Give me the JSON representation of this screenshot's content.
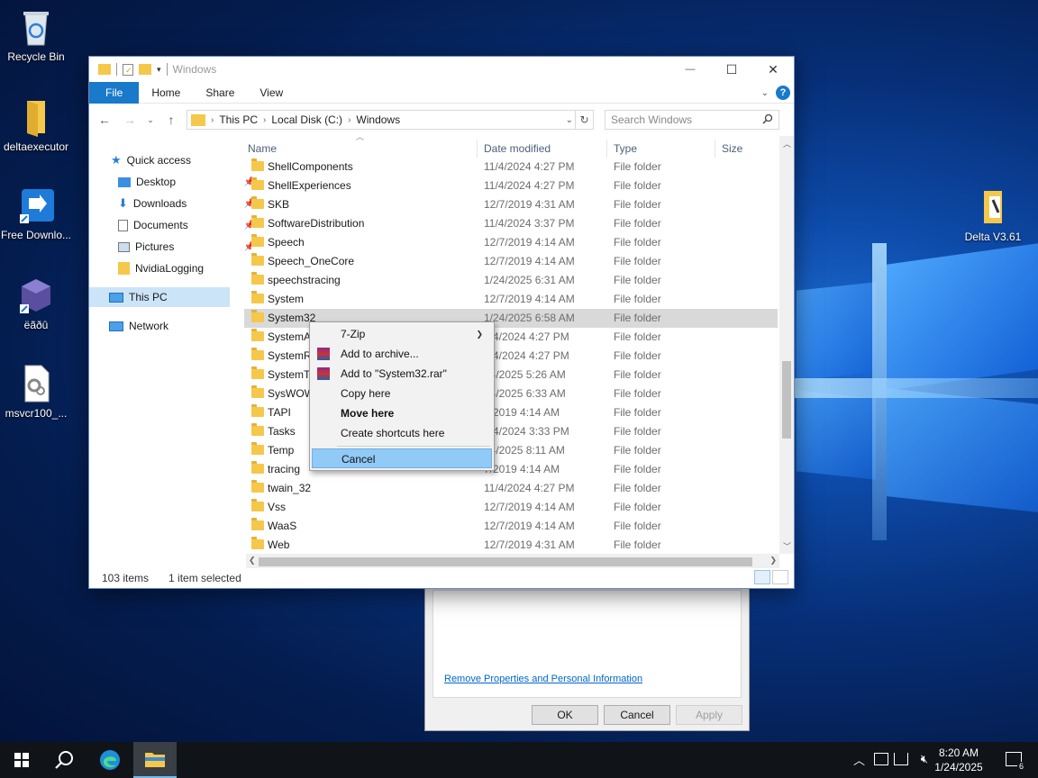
{
  "desktop": {
    "icons": [
      {
        "label": "Recycle Bin"
      },
      {
        "label": "deltaexecutor"
      },
      {
        "label": "Free Downlo..."
      },
      {
        "label": "ëãðû"
      },
      {
        "label": "msvcr100_..."
      },
      {
        "label": "Delta V3.61"
      }
    ]
  },
  "window": {
    "title": "Windows",
    "controls": {
      "minimize": "—",
      "maximize": "☐",
      "close": "✕"
    },
    "ribbon_tabs": [
      "File",
      "Home",
      "Share",
      "View"
    ],
    "address": {
      "crumbs": [
        "This PC",
        "Local Disk (C:)",
        "Windows"
      ]
    },
    "search": {
      "placeholder": "Search Windows"
    },
    "nav": [
      {
        "label": "Quick access"
      },
      {
        "label": "Desktop"
      },
      {
        "label": "Downloads"
      },
      {
        "label": "Documents"
      },
      {
        "label": "Pictures"
      },
      {
        "label": "NvidiaLogging"
      },
      {
        "label": "This PC"
      },
      {
        "label": "Network"
      }
    ],
    "columns": [
      "Name",
      "Date modified",
      "Type",
      "Size"
    ],
    "rows": [
      {
        "name": "ShellComponents",
        "date": "11/4/2024 4:27 PM",
        "type": "File folder"
      },
      {
        "name": "ShellExperiences",
        "date": "11/4/2024 4:27 PM",
        "type": "File folder"
      },
      {
        "name": "SKB",
        "date": "12/7/2019 4:31 AM",
        "type": "File folder"
      },
      {
        "name": "SoftwareDistribution",
        "date": "11/4/2024 3:37 PM",
        "type": "File folder"
      },
      {
        "name": "Speech",
        "date": "12/7/2019 4:14 AM",
        "type": "File folder"
      },
      {
        "name": "Speech_OneCore",
        "date": "12/7/2019 4:14 AM",
        "type": "File folder"
      },
      {
        "name": "speechstracing",
        "date": "1/24/2025 6:31 AM",
        "type": "File folder"
      },
      {
        "name": "System",
        "date": "12/7/2019 4:14 AM",
        "type": "File folder"
      },
      {
        "name": "System32",
        "date": "1/24/2025 6:58 AM",
        "type": "File folder"
      },
      {
        "name": "SystemA",
        "date": "1/4/2024 4:27 PM",
        "type": "File folder"
      },
      {
        "name": "SystemR",
        "date": "1/4/2024 4:27 PM",
        "type": "File folder"
      },
      {
        "name": "SystemTe",
        "date": "24/2025 5:26 AM",
        "type": "File folder"
      },
      {
        "name": "SysWOW",
        "date": "24/2025 6:33 AM",
        "type": "File folder"
      },
      {
        "name": "TAPI",
        "date": "7/2019 4:14 AM",
        "type": "File folder"
      },
      {
        "name": "Tasks",
        "date": "1/4/2024 3:33 PM",
        "type": "File folder"
      },
      {
        "name": "Temp",
        "date": "24/2025 8:11 AM",
        "type": "File folder"
      },
      {
        "name": "tracing",
        "date": "7/2019 4:14 AM",
        "type": "File folder"
      },
      {
        "name": "twain_32",
        "date": "11/4/2024 4:27 PM",
        "type": "File folder"
      },
      {
        "name": "Vss",
        "date": "12/7/2019 4:14 AM",
        "type": "File folder"
      },
      {
        "name": "WaaS",
        "date": "12/7/2019 4:14 AM",
        "type": "File folder"
      },
      {
        "name": "Web",
        "date": "12/7/2019 4:31 AM",
        "type": "File folder"
      }
    ],
    "status": {
      "items": "103 items",
      "selected": "1 item selected"
    }
  },
  "context_menu": {
    "items": [
      "7-Zip",
      "Add to archive...",
      "Add to \"System32.rar\"",
      "Copy here",
      "Move here",
      "Create shortcuts here",
      "Cancel"
    ]
  },
  "properties_dialog": {
    "link": "Remove Properties and Personal Information",
    "buttons": [
      "OK",
      "Cancel",
      "Apply"
    ]
  },
  "taskbar": {
    "time": "8:20 AM",
    "date": "1/24/2025",
    "notification_count": "6"
  },
  "colors": {
    "accent": "#1979ca",
    "selection": "#cce4f7",
    "menu_hover": "#91c9f7"
  }
}
